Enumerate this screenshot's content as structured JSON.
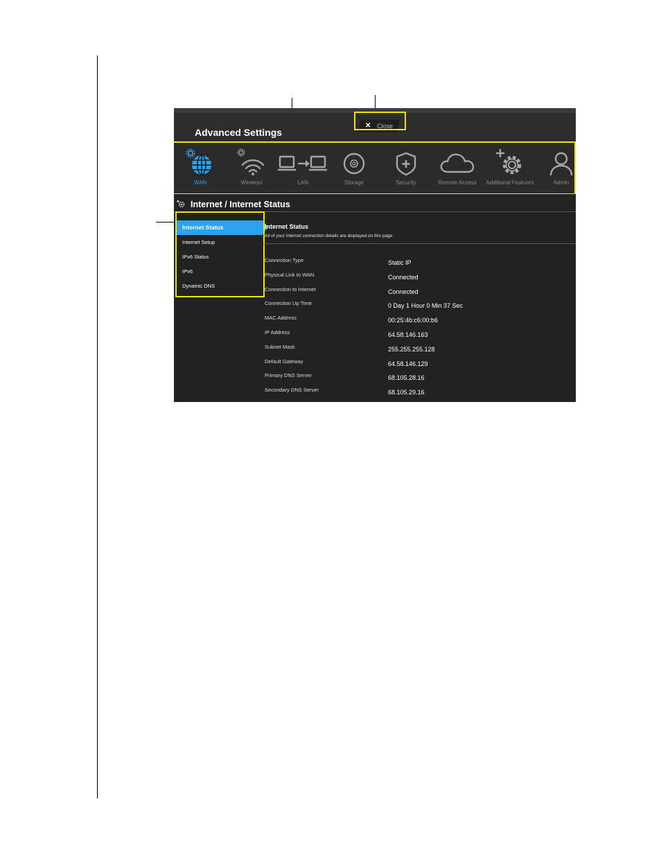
{
  "window": {
    "title": "Advanced Settings",
    "close_label": "Close"
  },
  "nav": {
    "items": [
      {
        "label": "WAN",
        "icon": "globe-icon",
        "active": true
      },
      {
        "label": "Wireless",
        "icon": "wifi-icon",
        "active": false
      },
      {
        "label": "LAN",
        "icon": "lan-icon",
        "active": false
      },
      {
        "label": "Storage",
        "icon": "storage-disc-icon",
        "active": false
      },
      {
        "label": "Security",
        "icon": "shield-icon",
        "active": false
      },
      {
        "label": "Remote Access",
        "icon": "cloud-icon",
        "active": false
      },
      {
        "label": "Additional Features",
        "icon": "gear-plus-icon",
        "active": false
      },
      {
        "label": "Admin",
        "icon": "user-icon",
        "active": false
      }
    ]
  },
  "section": {
    "title": "Internet / Internet Status"
  },
  "sidebar": {
    "items": [
      {
        "label": "Internet Status",
        "active": true
      },
      {
        "label": "Internet Setup",
        "active": false
      },
      {
        "label": "IPv6 Status",
        "active": false
      },
      {
        "label": "IPv6",
        "active": false
      },
      {
        "label": "Dynamic DNS",
        "active": false
      }
    ]
  },
  "content": {
    "title": "Internet Status",
    "description": "All of your Internet connection details are displayed on this page.",
    "rows": [
      {
        "label": "Connection Type",
        "value": "Static IP"
      },
      {
        "label": "Physical Link to WAN",
        "value": "Connected"
      },
      {
        "label": "Connection to Internet",
        "value": "Connected"
      },
      {
        "label": "Connection Up Time",
        "value": "0 Day 1 Hour 0 Min 37 Sec"
      },
      {
        "label": "MAC Address",
        "value": "00:25:4b:c6:00:b6"
      },
      {
        "label": "IP Address",
        "value": "64.58.146.163"
      },
      {
        "label": "Subnet Mask",
        "value": "255.255.255.128"
      },
      {
        "label": "Default Gateway",
        "value": "64.58.146.129"
      },
      {
        "label": "Primary DNS Server",
        "value": "68.105.28.16"
      },
      {
        "label": "Secondary DNS Server",
        "value": "68.105.29.16"
      }
    ]
  },
  "colors": {
    "accent": "#2aa4f0",
    "highlight": "#f2e600",
    "background": "#222222"
  }
}
